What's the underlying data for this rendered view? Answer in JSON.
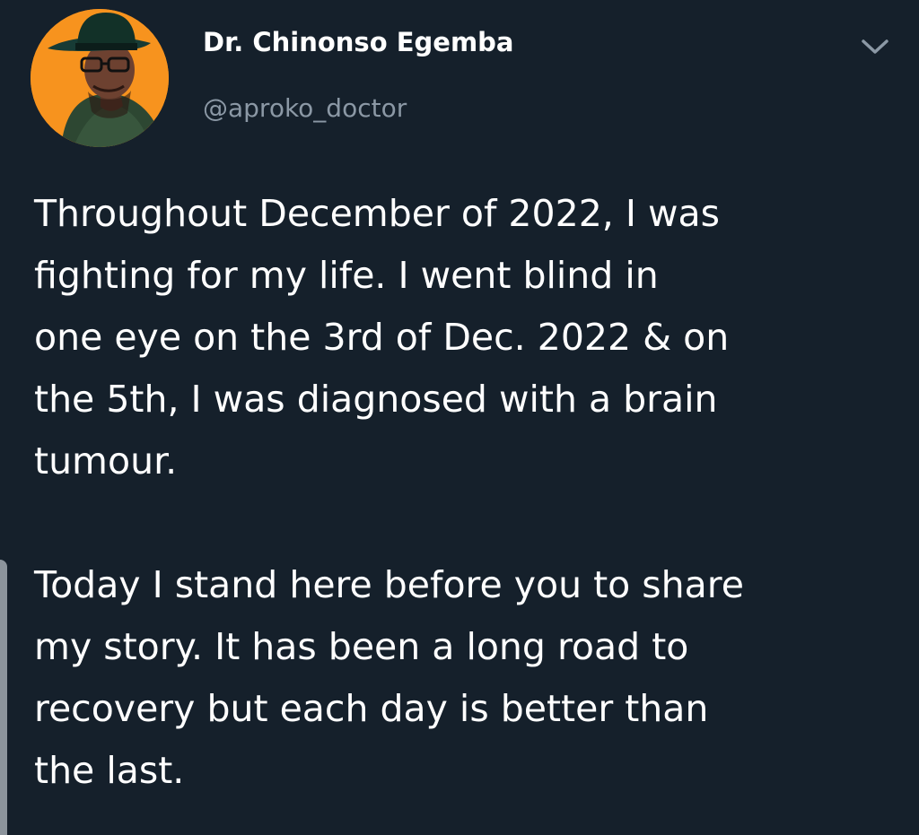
{
  "tweet": {
    "display_name": "Dr. Chinonso Egemba",
    "handle": "@aproko_doctor",
    "paragraphs": [
      "Throughout December of 2022, I was\nfighting for my life. I went blind in\none eye on the 3rd of Dec. 2022 & on\nthe 5th, I was diagnosed with a brain\ntumour.",
      "Today I stand here before you to share\nmy story. It has been a long road to\nrecovery but each day is better than\nthe last."
    ],
    "menu_icon": "chevron-down-icon",
    "avatar_icon": "profile-photo"
  },
  "colors": {
    "background": "#15202b",
    "text": "#ffffff",
    "secondary_text": "#8b98a5",
    "avatar_ring": "#f7931e"
  }
}
